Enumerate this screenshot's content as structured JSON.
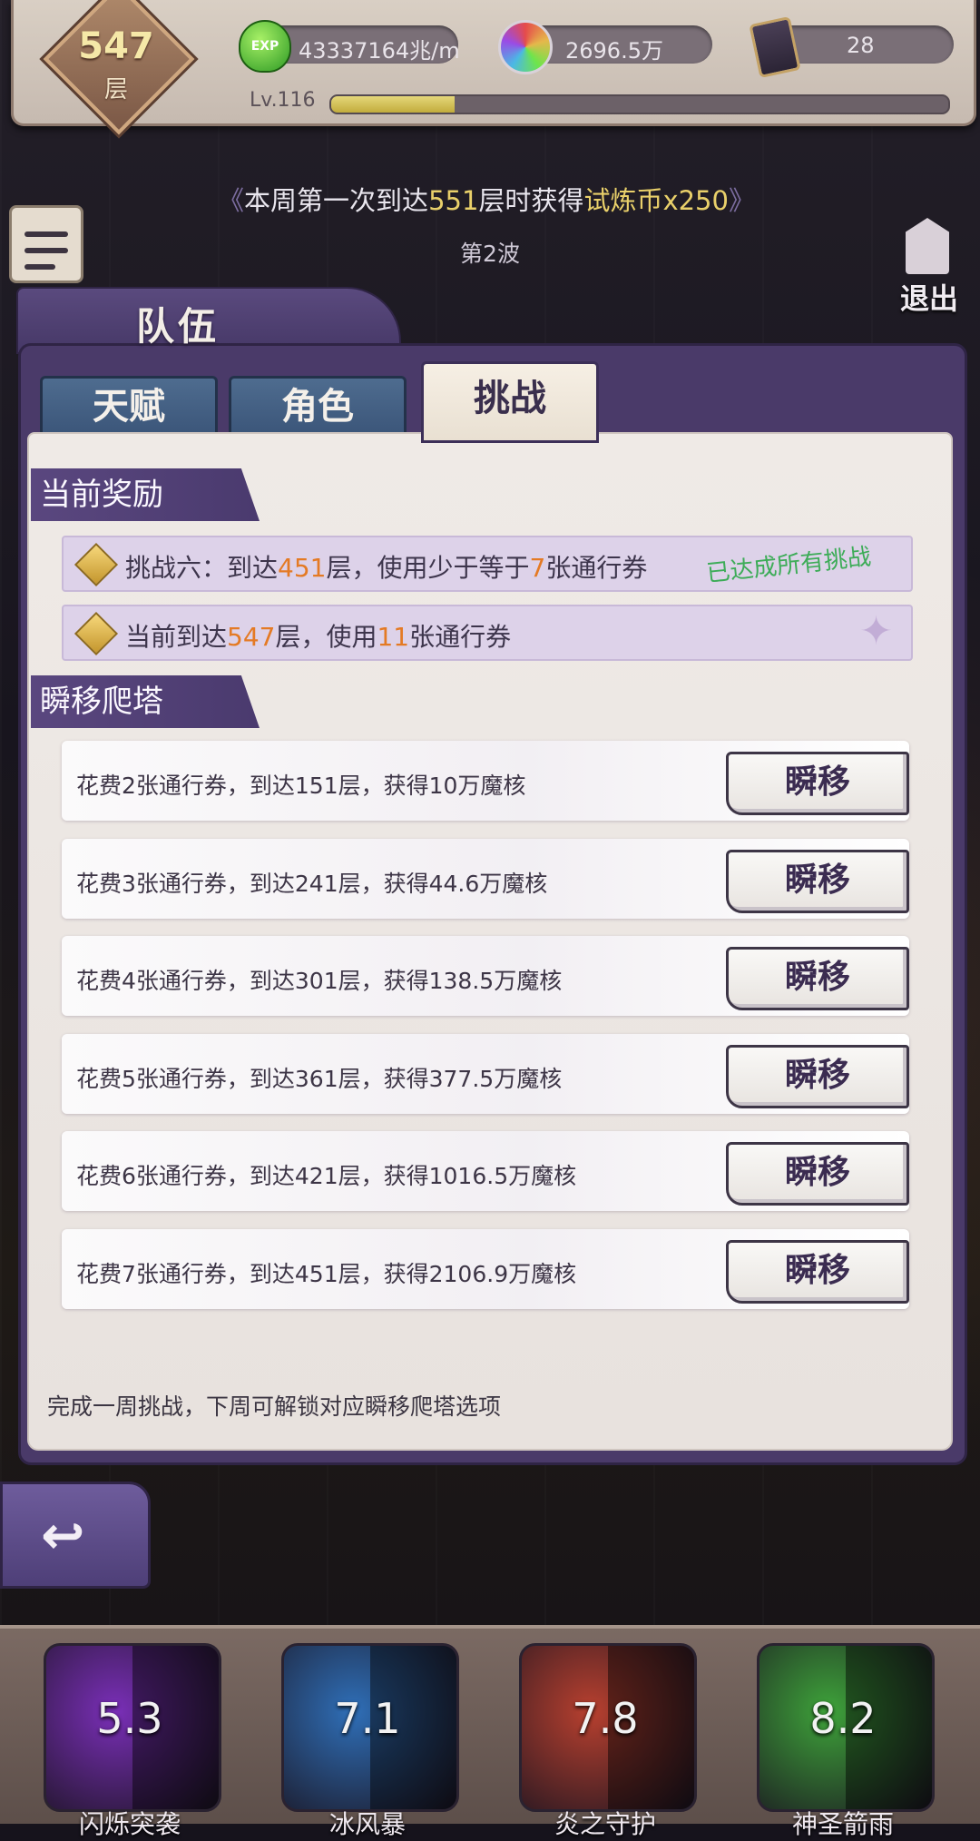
{
  "hud": {
    "floor_number": "547",
    "floor_unit": "层",
    "exp_icon_text": "EXP",
    "exp_value": "4333716​4兆/m",
    "core_value": "2696.5万",
    "pass_value": "28",
    "level_label": "Lv.116",
    "level_progress_percent": 20
  },
  "banner": {
    "left_chevron": "《",
    "prefix": "本周第一次到达",
    "floor": "551",
    "middle": "层时获得",
    "reward": "试炼币x250",
    "right_chevron": "》"
  },
  "wave_label": "第2波",
  "exit_label": "退出",
  "panel": {
    "title": "队伍",
    "tabs": [
      "天赋",
      "角色",
      "挑战"
    ],
    "active_tab": "挑战"
  },
  "current_reward": {
    "heading": "当前奖励",
    "challenge": {
      "p1": "挑战六：到达",
      "floor": "451",
      "p2": "层，使用少于等于",
      "count": "7",
      "p3": "张通行券",
      "status": "已达成所有挑战"
    },
    "current": {
      "p1": "当前到达",
      "floor": "547",
      "p2": "层，使用",
      "count": "11",
      "p3": "张通行券"
    }
  },
  "teleport": {
    "heading": "瞬移爬塔",
    "button_label": "瞬移",
    "rows": [
      {
        "text": "花费2张通行券，到达151层，获得10万魔核"
      },
      {
        "text": "花费3张通行券，到达241层，获得44.6万魔核"
      },
      {
        "text": "花费4张通行券，到达301层，获得138.5万魔核"
      },
      {
        "text": "花费5张通行券，到达361层，获得377.5万魔核"
      },
      {
        "text": "花费6张通行券，到达421层，获得1016.5万魔核"
      },
      {
        "text": "花费7张通行券，到达451层，获得2106.9万魔核"
      }
    ],
    "footer": "完成一周挑战，下周可解锁对应瞬移爬塔选项"
  },
  "skills": [
    {
      "cooldown": "5.3",
      "name": "闪烁突袭",
      "color": "#7a2fb8"
    },
    {
      "cooldown": "7.1",
      "name": "冰风暴",
      "color": "#2f6fb8"
    },
    {
      "cooldown": "7.8",
      "name": "炎之守护",
      "color": "#b8402f"
    },
    {
      "cooldown": "8.2",
      "name": "神圣箭雨",
      "color": "#3ea33a"
    }
  ]
}
